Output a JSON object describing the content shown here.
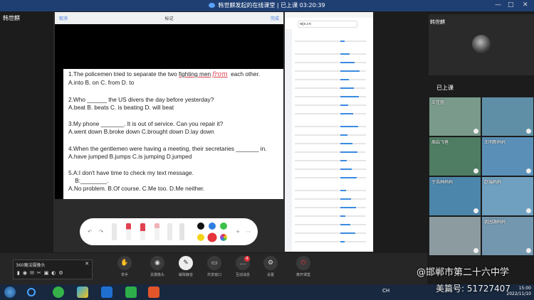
{
  "title_bar": {
    "title": "韩世麒发起的在线课堂 | 已上课 03:20:39",
    "controls": [
      "—",
      "□",
      "✕"
    ]
  },
  "presenter_name": "韩世麒",
  "tablet": {
    "header_left": "取消",
    "header_center": "标记",
    "header_right": "完成",
    "questions": [
      {
        "pre": "1.The policemen tried to separate the two ",
        "underlined": "fighting men",
        "handwritten": "from",
        "post": " each other."
      },
      {
        "text": "A.into       B. on    C. from    D. to"
      },
      {
        "text": "2.Who ______ the US divers the day before yesterday?"
      },
      {
        "text": "A.beat   B. beats   C. is beating   D. will beat"
      },
      {
        "text": "3.My phone _______. It is out of service. Can you repair it?"
      },
      {
        "text": "A.went down    B.broke down   C.brought down   D.lay down"
      },
      {
        "text": "4.When the gentlemen were having a meeting, their secretaries _______ in."
      },
      {
        "text": "A.have jumped    B.jumps    C.is jumping    D.jumped"
      },
      {
        "text": "5.A:I don't have time to check my text message."
      },
      {
        "text": "    B:________."
      },
      {
        "text": "A.No problem.    B.Of course.     C.Me too.    D.Me neither."
      }
    ]
  },
  "browser": {
    "url": "wjx.cn"
  },
  "toolbar_colors": {
    "black": "#111111",
    "blue": "#2f7de1",
    "green": "#3cc04a",
    "yellow": "#f5d418",
    "red": "#e5343a"
  },
  "cam360": {
    "title": "360魔法摄像头",
    "close": "✕"
  },
  "bottom_bar": {
    "buttons": [
      {
        "label": "举手",
        "icon": "hand-icon",
        "glyph": "✋"
      },
      {
        "label": "关摄像头",
        "icon": "camera-icon",
        "glyph": "◉"
      },
      {
        "label": "解除静音",
        "icon": "mic-icon",
        "glyph": "✎"
      },
      {
        "label": "共享窗口",
        "icon": "screen-share-icon",
        "glyph": "▭"
      },
      {
        "label": "互动消息",
        "icon": "message-icon",
        "glyph": "…",
        "badge": "4"
      },
      {
        "label": "设置",
        "icon": "gear-icon",
        "glyph": "⚙"
      },
      {
        "label": "离开课堂",
        "icon": "power-icon",
        "glyph": "⏻"
      }
    ]
  },
  "right_panel": {
    "teacher_name": "韩世麒",
    "status": "已上课",
    "participants": [
      {
        "name": "王佳茵"
      },
      {
        "name": ""
      },
      {
        "name": "周启飞爸"
      },
      {
        "name": "王明新妈妈"
      },
      {
        "name": "于浩林妈妈"
      },
      {
        "name": "赵瑞妈妈"
      },
      {
        "name": ""
      },
      {
        "name": "武园源妈妈"
      }
    ]
  },
  "watermark": {
    "school": "@邯郸市第二十六中学",
    "id": "美篇号: 51727407"
  },
  "taskbar": {
    "ime": "CH",
    "time": "15:00",
    "date": "2022/11/10"
  }
}
